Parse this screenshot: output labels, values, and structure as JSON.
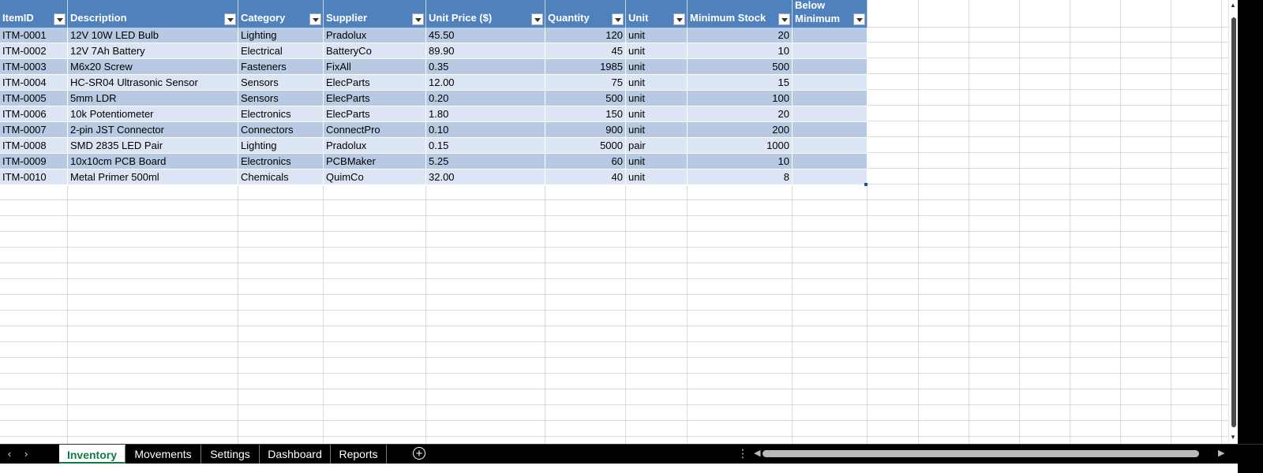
{
  "table": {
    "columns": [
      {
        "label": "ItemID"
      },
      {
        "label": "Description"
      },
      {
        "label": "Category"
      },
      {
        "label": "Supplier"
      },
      {
        "label": "Unit Price ($)"
      },
      {
        "label": "Quantity"
      },
      {
        "label": "Unit"
      },
      {
        "label": "Minimum Stock"
      },
      {
        "label": "Below Minimum"
      }
    ],
    "rows": [
      {
        "id": "ITM-0001",
        "description": "12V 10W LED Bulb",
        "category": "Lighting",
        "supplier": "Pradolux",
        "price": "45.50",
        "quantity": "120",
        "unit": "unit",
        "min_stock": "20",
        "below_min": ""
      },
      {
        "id": "ITM-0002",
        "description": "12V 7Ah Battery",
        "category": "Electrical",
        "supplier": "BatteryCo",
        "price": "89.90",
        "quantity": "45",
        "unit": "unit",
        "min_stock": "10",
        "below_min": ""
      },
      {
        "id": "ITM-0003",
        "description": "M6x20 Screw",
        "category": "Fasteners",
        "supplier": "FixAll",
        "price": "0.35",
        "quantity": "1985",
        "unit": "unit",
        "min_stock": "500",
        "below_min": ""
      },
      {
        "id": "ITM-0004",
        "description": "HC-SR04 Ultrasonic Sensor",
        "category": "Sensors",
        "supplier": "ElecParts",
        "price": "12.00",
        "quantity": "75",
        "unit": "unit",
        "min_stock": "15",
        "below_min": ""
      },
      {
        "id": "ITM-0005",
        "description": "5mm LDR",
        "category": "Sensors",
        "supplier": "ElecParts",
        "price": "0.20",
        "quantity": "500",
        "unit": "unit",
        "min_stock": "100",
        "below_min": ""
      },
      {
        "id": "ITM-0006",
        "description": "10k Potentiometer",
        "category": "Electronics",
        "supplier": "ElecParts",
        "price": "1.80",
        "quantity": "150",
        "unit": "unit",
        "min_stock": "20",
        "below_min": ""
      },
      {
        "id": "ITM-0007",
        "description": "2-pin JST Connector",
        "category": "Connectors",
        "supplier": "ConnectPro",
        "price": "0.10",
        "quantity": "900",
        "unit": "unit",
        "min_stock": "200",
        "below_min": ""
      },
      {
        "id": "ITM-0008",
        "description": "SMD 2835 LED Pair",
        "category": "Lighting",
        "supplier": "Pradolux",
        "price": "0.15",
        "quantity": "5000",
        "unit": "pair",
        "min_stock": "1000",
        "below_min": ""
      },
      {
        "id": "ITM-0009",
        "description": "10x10cm PCB Board",
        "category": "Electronics",
        "supplier": "PCBMaker",
        "price": "5.25",
        "quantity": "60",
        "unit": "unit",
        "min_stock": "10",
        "below_min": ""
      },
      {
        "id": "ITM-0010",
        "description": "Metal Primer 500ml",
        "category": "Chemicals",
        "supplier": "QuimCo",
        "price": "32.00",
        "quantity": "40",
        "unit": "unit",
        "min_stock": "8",
        "below_min": ""
      }
    ]
  },
  "sheet_tabs": [
    {
      "label": "Inventory",
      "active": true
    },
    {
      "label": "Movements",
      "active": false
    },
    {
      "label": "Settings",
      "active": false
    },
    {
      "label": "Dashboard",
      "active": false
    },
    {
      "label": "Reports",
      "active": false
    }
  ],
  "icons": {
    "tab_prev": "chevron-left-icon",
    "tab_next": "chevron-right-icon",
    "add_sheet": "plus-circle-icon",
    "options": "vertical-dots-icon",
    "filter": "filter-dropdown-icon"
  },
  "colors": {
    "header_bg": "#4f81bd",
    "band_dark": "#b8c9e4",
    "band_light": "#dce5f3",
    "active_tab_text": "#107c41"
  }
}
